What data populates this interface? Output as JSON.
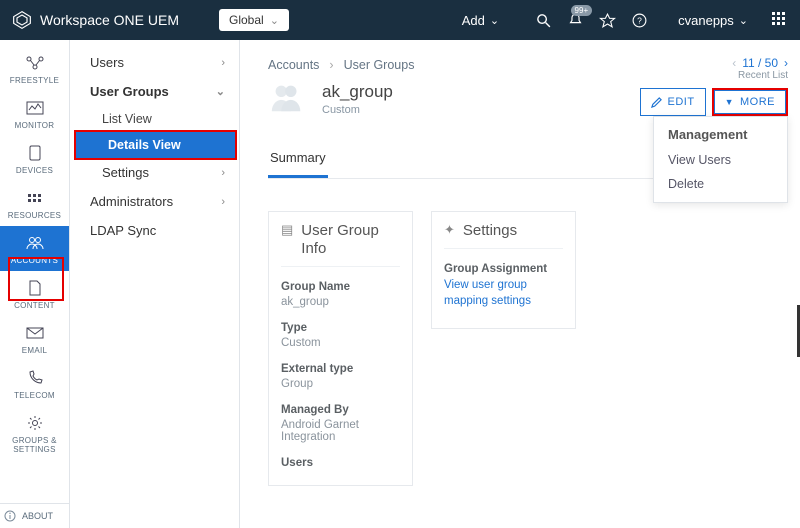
{
  "brand": "Workspace ONE UEM",
  "global_selector": "Global",
  "add_label": "Add",
  "notification_badge": "99+",
  "user": "cvanepps",
  "rail": [
    {
      "label": "FREESTYLE"
    },
    {
      "label": "MONITOR"
    },
    {
      "label": "DEVICES"
    },
    {
      "label": "RESOURCES"
    },
    {
      "label": "ACCOUNTS"
    },
    {
      "label": "CONTENT"
    },
    {
      "label": "EMAIL"
    },
    {
      "label": "TELECOM"
    },
    {
      "label": "GROUPS & SETTINGS"
    }
  ],
  "about": "ABOUT",
  "nav2": {
    "users": "Users",
    "user_groups": "User Groups",
    "list_view": "List View",
    "details_view": "Details View",
    "settings": "Settings",
    "administrators": "Administrators",
    "ldap_sync": "LDAP Sync"
  },
  "crumbs": {
    "accounts": "Accounts",
    "user_groups": "User Groups"
  },
  "recent": {
    "pos": "11 / 50",
    "label": "Recent List"
  },
  "page": {
    "title": "ak_group",
    "subtitle": "Custom"
  },
  "actions": {
    "edit": "EDIT",
    "more": "MORE"
  },
  "tabs": {
    "summary": "Summary"
  },
  "card_info": {
    "title": "User Group Info",
    "group_name_label": "Group Name",
    "group_name": "ak_group",
    "type_label": "Type",
    "type": "Custom",
    "external_type_label": "External type",
    "external_type": "Group",
    "managed_by_label": "Managed By",
    "managed_by": "Android Garnet Integration",
    "users_label": "Users"
  },
  "card_settings": {
    "title": "Settings",
    "group_assignment_label": "Group Assignment",
    "link": "View user group mapping settings"
  },
  "menu": {
    "head": "Management",
    "view_users": "View Users",
    "delete": "Delete"
  }
}
